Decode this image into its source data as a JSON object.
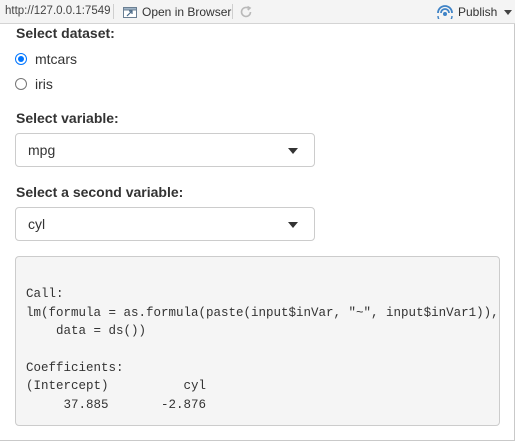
{
  "toolbar": {
    "url": "http://127.0.0.1:7549",
    "open_browser_label": "Open in Browser",
    "publish_label": "Publish",
    "icons": {
      "open_browser": "open-in-browser-icon",
      "refresh": "refresh-icon",
      "publish": "publish-icon",
      "caret": "chevron-down-icon"
    }
  },
  "dataset": {
    "label": "Select dataset:",
    "options": [
      {
        "label": "mtcars",
        "checked": true
      },
      {
        "label": "iris",
        "checked": false
      }
    ]
  },
  "variable": {
    "label": "Select variable:",
    "value": "mpg"
  },
  "variable2": {
    "label": "Select a second variable:",
    "value": "cyl"
  },
  "output": {
    "lines": [
      "Call:",
      "lm(formula = as.formula(paste(input$inVar, \"~\", input$inVar1)),",
      "    data = ds())",
      "",
      "Coefficients:",
      "(Intercept)          cyl",
      "     37.885       -2.876"
    ]
  },
  "colors": {
    "accent": "#0075ff",
    "output_bg": "#f5f5f5",
    "border": "#cccccc"
  }
}
